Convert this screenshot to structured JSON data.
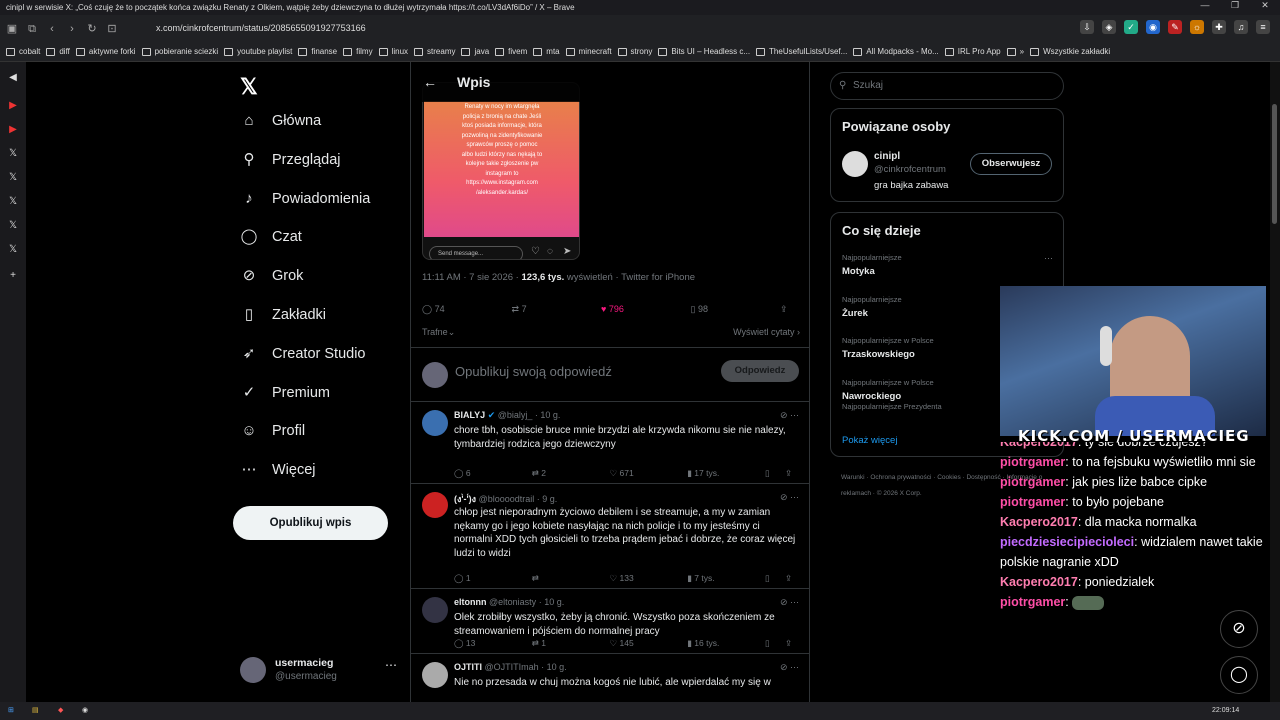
{
  "window": {
    "title": "cinipl w serwisie X: „Coś czuję że to początek końca związku Renaty z Olkiem, wątpię żeby dziewczyna to dłużej wytrzymała https://t.co/LV3dAf6iDo” / X – Brave"
  },
  "browser": {
    "url": "x.com/cinkrofcentrum/status/2085655091927753166"
  },
  "bookmarks": [
    "cobalt",
    "diff",
    "aktywne forki",
    "pobieranie sciezki",
    "youtube playlist",
    "finanse",
    "filmy",
    "linux",
    "streamy",
    "java",
    "fivem",
    "mta",
    "minecraft",
    "strony",
    "Bits UI – Headless c...",
    "TheUsefulLists/Usef...",
    "All Modpacks - Mo...",
    "IRL Pro App",
    "»",
    "Wszystkie zakładki"
  ],
  "nav": {
    "items": [
      {
        "label": "Główna",
        "icon": "home-icon",
        "glyph": "⌂"
      },
      {
        "label": "Przeglądaj",
        "icon": "search-icon",
        "glyph": "⚲"
      },
      {
        "label": "Powiadomienia",
        "icon": "bell-icon",
        "glyph": "♪"
      },
      {
        "label": "Czat",
        "icon": "chat-icon",
        "glyph": "◯"
      },
      {
        "label": "Grok",
        "icon": "grok-icon",
        "glyph": "⊘"
      },
      {
        "label": "Zakładki",
        "icon": "bookmark-icon",
        "glyph": "▯"
      },
      {
        "label": "Creator Studio",
        "icon": "rocket-icon",
        "glyph": "➶"
      },
      {
        "label": "Premium",
        "icon": "verified-icon",
        "glyph": "✓"
      },
      {
        "label": "Profil",
        "icon": "profile-icon",
        "glyph": "☺"
      },
      {
        "label": "Więcej",
        "icon": "more-icon",
        "glyph": "⋯"
      }
    ],
    "post_button": "Opublikuj wpis",
    "account": {
      "name": "usermacieg",
      "handle": "@usermacieg"
    }
  },
  "header": {
    "title": "Wpis"
  },
  "post": {
    "image_text": "Renaty w nocy im wtargnęła\npolicja z bronią na chate Jeśli\nktoś posiada informacje, która\npozwoliną na zidentyfikowanie\nsprawców proszę o pomoc\nalbo ludzi którzy nas nękają to\nkolejne takie zgłoszenie pw\ninstagram to\nhttps://www.instagram.com\n/aleksander.kardas/",
    "send_placeholder": "Send message...",
    "time": "11:11 AM · 7 sie 2026 ·",
    "views": "123,6 tys.",
    "views_label": "wyświetleń · Twitter for iPhone",
    "replies": "74",
    "reposts": "7",
    "likes": "796",
    "bookmarks": "98",
    "sort_label": "Trafne",
    "quotes_label": "Wyświetl cytaty"
  },
  "reply_box": {
    "placeholder": "Opublikuj swoją odpowiedź",
    "button": "Odpowiedz"
  },
  "tweets": [
    {
      "name": "BIALYJ",
      "handle": "@bialyj_",
      "time": "10 g.",
      "text": "chore tbh, osobiscie bruce mnie brzydzi ale krzywda nikomu sie nie nalezy, tymbardziej rodzica jego dziewczyny",
      "replies": "6",
      "reposts": "2",
      "likes": "671",
      "views": "17 tys."
    },
    {
      "name": "(ง'̀-'́)ง",
      "handle": "@bloooodtrail",
      "time": "9 g.",
      "text": "chłop jest nieporadnym życiowo debilem i se streamuje, a my w zamian nękamy go i jego kobiete nasyłając na nich policje i to my jesteśmy ci normalni XDD tych głosicieli to trzeba prądem jebać i dobrze, że coraz więcej ludzi to widzi",
      "replies": "1",
      "reposts": "",
      "likes": "133",
      "views": "7 tys."
    },
    {
      "name": "eltonnn",
      "handle": "@eltoniasty",
      "time": "10 g.",
      "text": "Olek zrobiłby wszystko, żeby ją chronić. Wszystko poza skończeniem ze streamowaniem i pójściem do normalnej pracy",
      "replies": "13",
      "reposts": "1",
      "likes": "145",
      "views": "16 tys."
    },
    {
      "name": "OJTITI",
      "handle": "@OJTITImah",
      "time": "10 g.",
      "text": "Nie no przesada w chuj można kogoś nie lubić, ale wpierdalać my się w",
      "replies": "",
      "reposts": "",
      "likes": "",
      "views": ""
    }
  ],
  "right": {
    "search_placeholder": "Szukaj",
    "related_title": "Powiązane osoby",
    "related": {
      "name": "cinipl",
      "handle": "@cinkrofcentrum",
      "bio": "gra bajka zabawa",
      "button": "Obserwujesz"
    },
    "trends_title": "Co się dzieje",
    "trends": [
      {
        "cat": "Najpopularniejsze",
        "name": "Motyka",
        "extra": ""
      },
      {
        "cat": "Najpopularniejsze",
        "name": "Żurek",
        "extra": ""
      },
      {
        "cat": "Najpopularniejsze w Polsce",
        "name": "Trzaskowskiego",
        "extra": ""
      },
      {
        "cat": "Najpopularniejsze w Polsce",
        "name": "Nawrockiego",
        "extra": "Najpopularniejsze Prezydenta"
      }
    ],
    "show_more": "Pokaż więcej",
    "footer": "Warunki · Ochrona prywatności · Cookies · Dostępność · Informacje o reklamach · © 2026 X Corp."
  },
  "stream": {
    "overlay": "KICK.COM / USERMACIEG",
    "chat": [
      {
        "user": "Kacpero2017",
        "color": "#ff7eb0",
        "text": "ty sie dobrze czujesz?"
      },
      {
        "user": "piotrgamer",
        "color": "#ff4fa8",
        "text": "to na fejsbuku wyświetliło mni sie"
      },
      {
        "user": "piotrgamer",
        "color": "#ff4fa8",
        "text": "jak pies liże babce cipke"
      },
      {
        "user": "piotrgamer",
        "color": "#ff4fa8",
        "text": "to było pojebane"
      },
      {
        "user": "Kacpero2017",
        "color": "#ff7eb0",
        "text": "dla macka normalka"
      },
      {
        "user": "piecdziesiecipiecioleci",
        "color": "#c36bff",
        "text": "widzialem nawet takie polskie nagranie xDD"
      },
      {
        "user": "Kacpero2017",
        "color": "#ff7eb0",
        "text": "poniedzialek"
      },
      {
        "user": "piotrgamer",
        "color": "#ff4fa8",
        "text": ""
      }
    ]
  },
  "taskbar": {
    "time": "22:09:14"
  },
  "colors": {
    "like": "#f91880",
    "verified": "#1d9bf0",
    "link": "#1d9bf0"
  }
}
